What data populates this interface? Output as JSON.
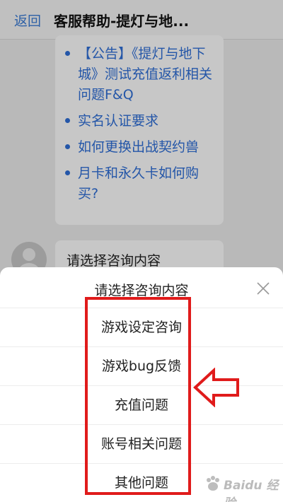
{
  "header": {
    "back_label": "返回",
    "title": "客服帮助-提灯与地..."
  },
  "chat": {
    "links": [
      "【公告】《提灯与地下城》测试充值返利相关问题F&Q",
      "实名认证要求",
      "如何更换出战契约兽",
      "月卡和永久卡如何购买?"
    ],
    "prompt_message": "请选择咨询内容"
  },
  "sheet": {
    "title": "请选择咨询内容",
    "options": [
      "游戏设定咨询",
      "游戏bug反馈",
      "充值问题",
      "账号相关问题",
      "其他问题"
    ]
  },
  "annotation": {
    "highlight_color": "#e01b1b"
  },
  "watermark": {
    "text": "Baidu 经验"
  },
  "colors": {
    "link": "#2f6fd8",
    "back": "#3a7bd5"
  }
}
